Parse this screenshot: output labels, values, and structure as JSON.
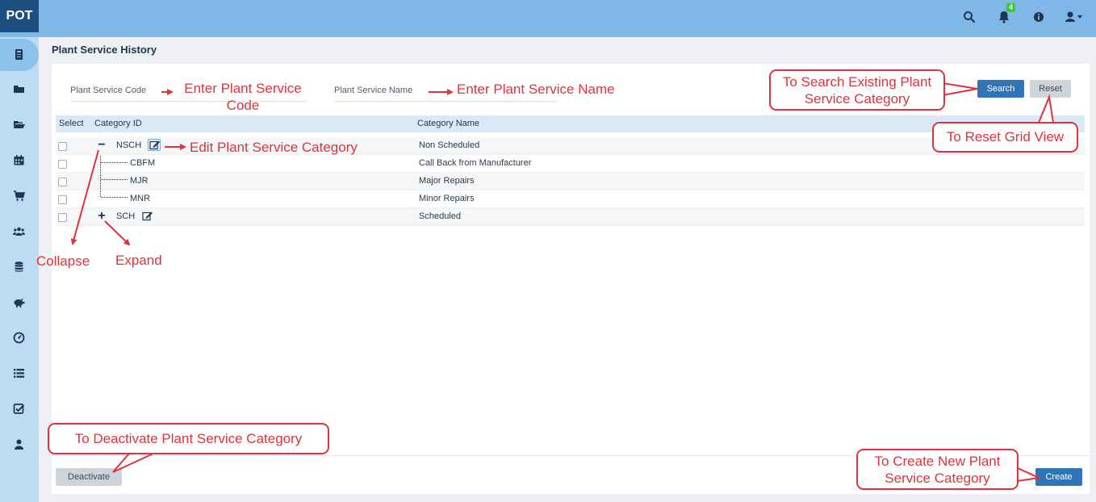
{
  "app": {
    "logo": "POT",
    "notifications_count": "4"
  },
  "header_icons": [
    "search-icon",
    "bell-icon",
    "info-icon",
    "user-icon",
    "caret-down-icon"
  ],
  "sidebar": {
    "items": [
      {
        "icon": "dashboard-icon",
        "active": true
      },
      {
        "icon": "folder-icon"
      },
      {
        "icon": "folder-open-icon"
      },
      {
        "icon": "calendar-icon"
      },
      {
        "icon": "cart-icon"
      },
      {
        "icon": "users-icon"
      },
      {
        "icon": "database-icon"
      },
      {
        "icon": "piggy-bank-icon"
      },
      {
        "icon": "dashboard-gauge-icon"
      },
      {
        "icon": "list-icon"
      },
      {
        "icon": "checklist-icon"
      },
      {
        "icon": "user-icon"
      }
    ]
  },
  "page": {
    "title": "Plant Service History"
  },
  "filters": {
    "code_label": "Plant Service Code",
    "code_value": "",
    "name_label": "Plant Service Name",
    "name_value": "",
    "search_label": "Search",
    "reset_label": "Reset"
  },
  "grid": {
    "columns": {
      "select": "Select",
      "category_id": "Category ID",
      "category_name": "Category Name"
    },
    "rows": [
      {
        "code": "NSCH",
        "name": "Non Scheduled",
        "toggle": "−",
        "parent": true,
        "expanded": true
      },
      {
        "code": "CBFM",
        "name": "Call Back from Manufacturer",
        "parent": false
      },
      {
        "code": "MJR",
        "name": "Major Repairs",
        "parent": false
      },
      {
        "code": "MNR",
        "name": "Minor Repairs",
        "parent": false
      },
      {
        "code": "SCH",
        "name": "Scheduled",
        "toggle": "+",
        "parent": true,
        "expanded": false
      }
    ]
  },
  "footer": {
    "deactivate_label": "Deactivate",
    "create_label": "Create"
  },
  "annotations": {
    "enter_code": "Enter Plant Service Code",
    "enter_name": "Enter Plant Service Name",
    "search_hint": "To Search Existing Plant Service Category",
    "reset_hint": "To Reset Grid View",
    "edit_hint": "Edit Plant Service Category",
    "collapse": "Collapse",
    "expand": "Expand",
    "deactivate_hint": "To Deactivate Plant Service Category",
    "create_hint": "To Create New Plant Service Category"
  },
  "colors": {
    "header": "#7fb8e6",
    "sidebar": "#bcdcf4",
    "primary": "#2f74b5",
    "annotation": "#e0323a"
  }
}
